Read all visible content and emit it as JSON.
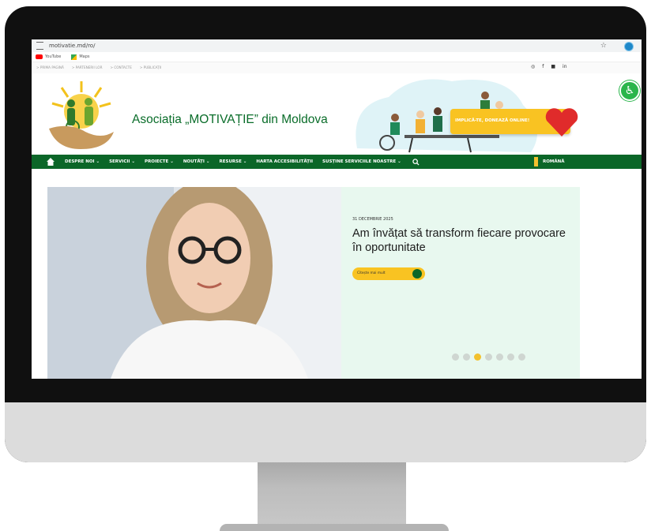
{
  "browser": {
    "url": "motivatie.md/ro/",
    "bookmarks": [
      {
        "label": "YouTube",
        "icon": "youtube-icon"
      },
      {
        "label": "Maps",
        "icon": "maps-icon"
      }
    ]
  },
  "site": {
    "top_links": [
      "> PRIMA PAGINĂ",
      "> PARTENERII LOR",
      "> CONTACTE",
      "> PUBLICAȚII"
    ],
    "socials": [
      "instagram-icon",
      "facebook-icon",
      "youtube-icon",
      "linkedin-icon"
    ],
    "organization_name": "Asociația „MOTIVAȚIE” din Moldova",
    "cta_label": "IMPLICĂ-TE, DONEAZĂ ONLINE!",
    "nav": [
      "DESPRE NOI ⌄",
      "SERVICII ⌄",
      "PROIECTE ⌄",
      "NOUTĂȚI ⌄",
      "RESURSE ⌄",
      "HARTA ACCESIBILITĂȚII",
      "SUSȚINE SERVICIILE NOASTRE ⌄"
    ],
    "language": "ROMÂNĂ",
    "hero": {
      "date": "31 DECEMBRIE 2025",
      "title": "Am învățat să transform fiecare provocare în oportunitate",
      "button_label": "Citește mai mult",
      "slide_count": 7,
      "active_slide": 2
    }
  },
  "colors": {
    "brand_green": "#0b6628",
    "accent_yellow": "#f9c322",
    "panel_bg": "#e8f8ef",
    "heart_red": "#e02b2b",
    "accessibility_green": "#2ab54b"
  }
}
